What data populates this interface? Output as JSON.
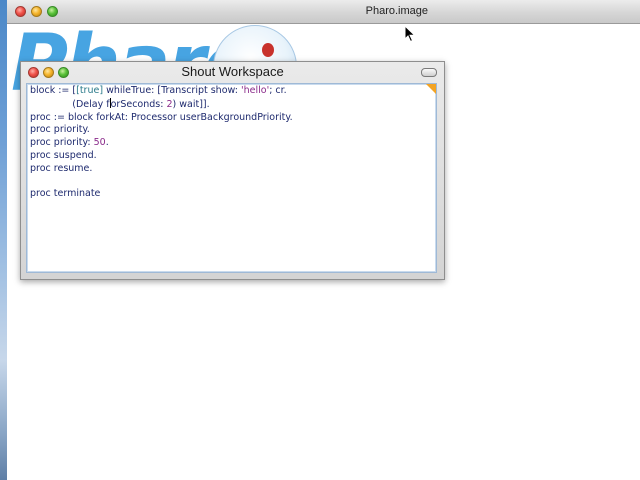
{
  "main_window": {
    "title": "Pharo.image"
  },
  "logo": {
    "text": "Pharo"
  },
  "workspace": {
    "title": "Shout Workspace",
    "lines": [
      [
        {
          "t": "block := [",
          "c": ""
        },
        {
          "t": "[true]",
          "c": "c-lit"
        },
        {
          "t": " whileTrue: [Transcript show: ",
          "c": ""
        },
        {
          "t": "'hello'",
          "c": "c-str"
        },
        {
          "t": "; cr.",
          "c": ""
        }
      ],
      [
        {
          "t": "              (Delay ",
          "c": ""
        },
        {
          "t": "f",
          "c": ""
        },
        {
          "t": "CURSOR",
          "c": "cursor"
        },
        {
          "t": "orSeconds: ",
          "c": ""
        },
        {
          "t": "2",
          "c": "c-num"
        },
        {
          "t": ") wait]].",
          "c": ""
        }
      ],
      [
        {
          "t": "proc := block forkAt: Processor userBackgroundPriority.",
          "c": ""
        }
      ],
      [
        {
          "t": "proc priority.",
          "c": ""
        }
      ],
      [
        {
          "t": "proc priority: ",
          "c": ""
        },
        {
          "t": "50",
          "c": "c-num"
        },
        {
          "t": ".",
          "c": ""
        }
      ],
      [
        {
          "t": "proc suspend.",
          "c": ""
        }
      ],
      [
        {
          "t": "proc resume.",
          "c": ""
        }
      ],
      [
        {
          "t": "",
          "c": ""
        }
      ],
      [
        {
          "t": "proc terminate",
          "c": ""
        }
      ]
    ]
  }
}
